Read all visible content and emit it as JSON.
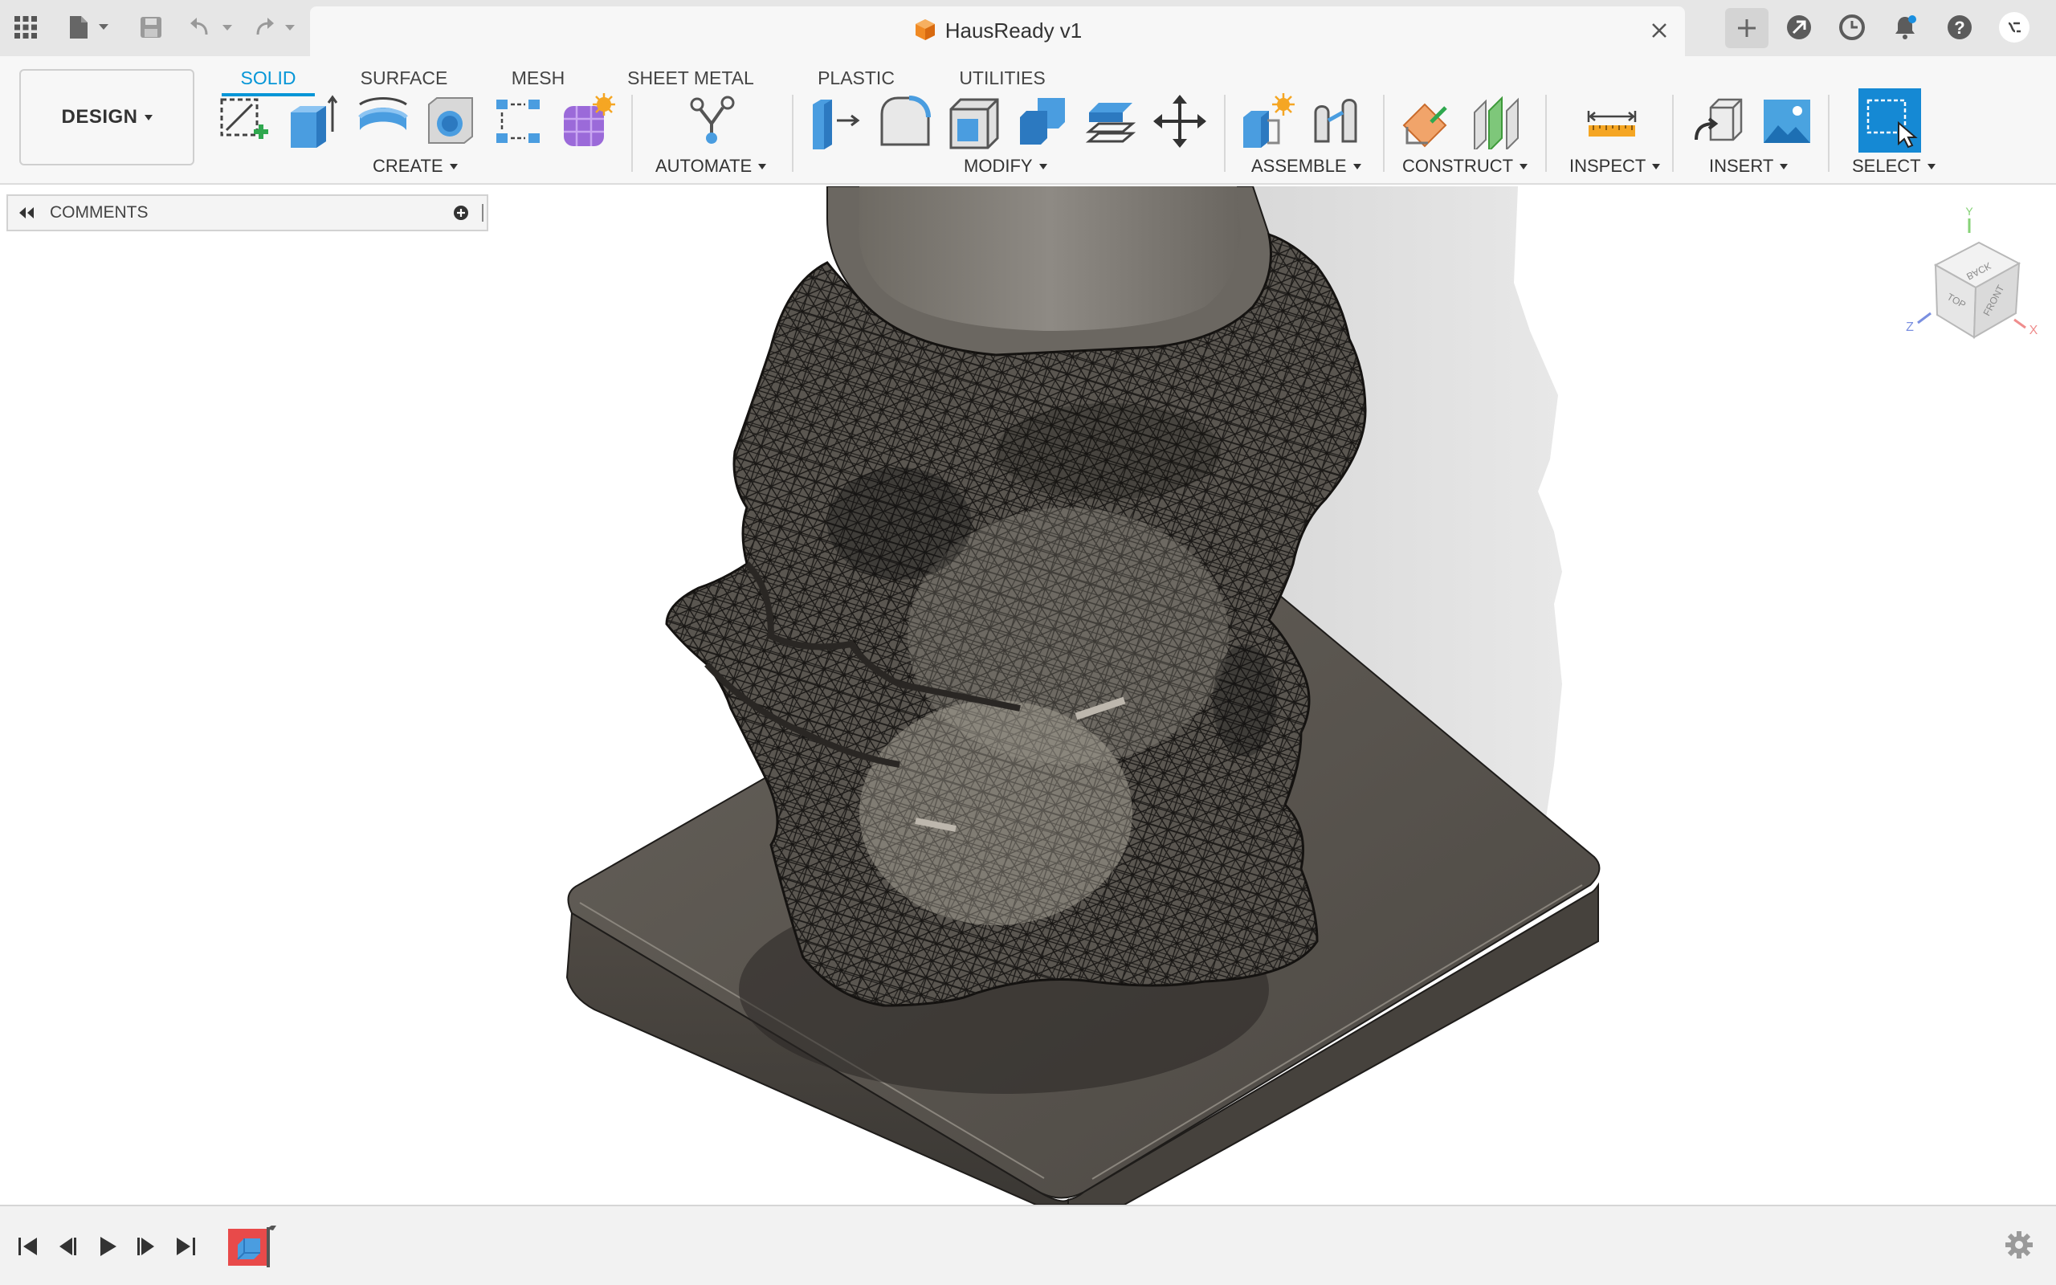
{
  "document": {
    "title": "HausReady v1"
  },
  "workspace": {
    "mode_label": "DESIGN"
  },
  "tabs": [
    {
      "label": "SOLID",
      "active": true
    },
    {
      "label": "SURFACE",
      "active": false
    },
    {
      "label": "MESH",
      "active": false
    },
    {
      "label": "SHEET METAL",
      "active": false
    },
    {
      "label": "PLASTIC",
      "active": false
    },
    {
      "label": "UTILITIES",
      "active": false
    }
  ],
  "groups": {
    "create": "CREATE",
    "automate": "AUTOMATE",
    "modify": "MODIFY",
    "assemble": "ASSEMBLE",
    "construct": "CONSTRUCT",
    "inspect": "INSPECT",
    "insert": "INSERT",
    "select": "SELECT"
  },
  "browser": {
    "comments_label": "COMMENTS"
  },
  "viewcube": {
    "top": "TOP",
    "front": "FRONT",
    "back": "BACK",
    "axis_x": "X",
    "axis_y": "Y",
    "axis_z": "Z"
  },
  "colors": {
    "accent": "#0696d7",
    "select_active": "#1589d4",
    "model_dark": "#4a4640",
    "base_plate": "#5d5850"
  },
  "icons": [
    "grid-menu-icon",
    "file-icon",
    "save-icon",
    "undo-icon",
    "redo-icon",
    "close-icon",
    "plus-icon",
    "extensions-icon",
    "job-status-icon",
    "notifications-icon",
    "help-icon",
    "profile-icon",
    "gear-icon"
  ]
}
